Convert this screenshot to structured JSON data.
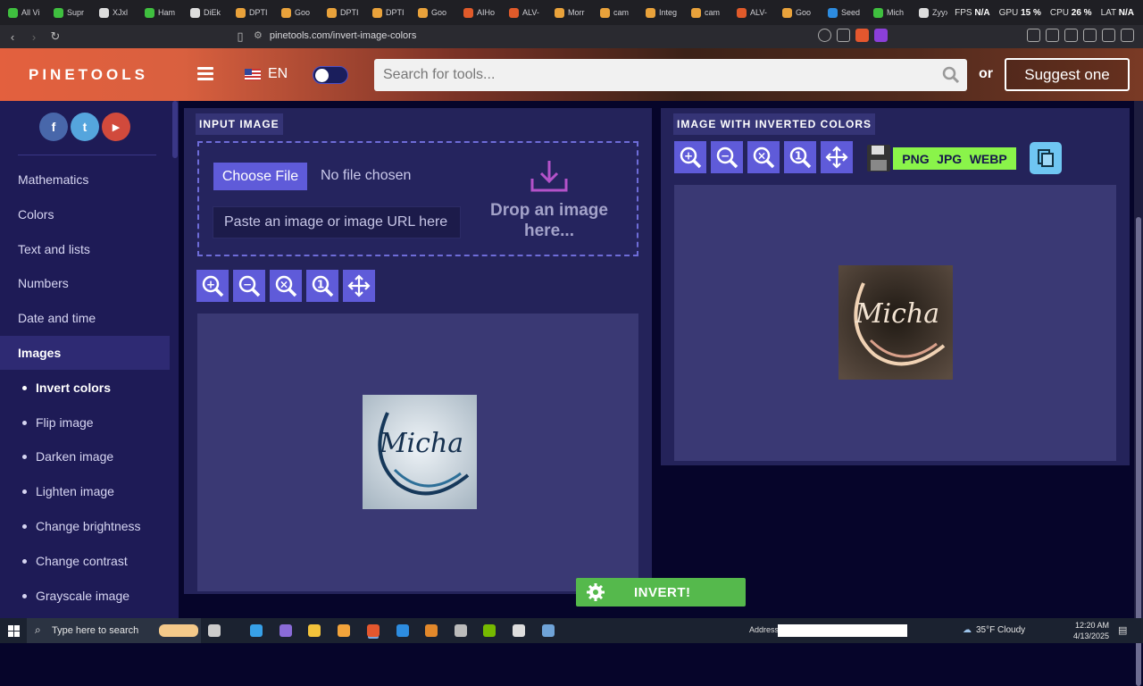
{
  "browser": {
    "tabs": [
      "All Vi",
      "Supr",
      "XJxl",
      "Ham",
      "DiEk",
      "DPTI",
      "Goo",
      "DPTI",
      "DPTI",
      "Goo",
      "AIHo",
      "ALV-",
      "Morr",
      "cam",
      "Integ",
      "cam",
      "ALV-",
      "Goo",
      "Seed",
      "Mich",
      "Zyyx"
    ],
    "perf": {
      "fps_label": "FPS",
      "fps_value": "N/A",
      "gpu_label": "GPU",
      "gpu_value": "15 %",
      "cpu_label": "CPU",
      "cpu_value": "26 %",
      "lat_label": "LAT",
      "lat_value": "N/A"
    },
    "url": "pinetools.com/invert-image-colors"
  },
  "header": {
    "logo": "PINETOOLS",
    "lang": "EN",
    "search_placeholder": "Search for tools...",
    "or": "or",
    "suggest": "Suggest one"
  },
  "sidebar": {
    "social": [
      "f",
      "t",
      "▶"
    ],
    "categories": [
      "Mathematics",
      "Colors",
      "Text and lists",
      "Numbers",
      "Date and time",
      "Images"
    ],
    "image_tools": [
      "Invert colors",
      "Flip image",
      "Darken image",
      "Lighten image",
      "Change brightness",
      "Change contrast",
      "Grayscale image"
    ]
  },
  "input_panel": {
    "title": "INPUT IMAGE",
    "choose_file": "Choose File",
    "no_file": "No file chosen",
    "paste_placeholder": "Paste an image or image URL here",
    "drop_text": "Drop an image here..."
  },
  "output_panel": {
    "title": "IMAGE WITH INVERTED COLORS",
    "formats": [
      "PNG",
      "JPG",
      "WEBP"
    ]
  },
  "image_text": "Micha",
  "invert_button": "INVERT!",
  "taskbar": {
    "search": "Type here to search",
    "address_label": "Address",
    "weather": "35°F  Cloudy",
    "time": "12:20 AM",
    "date": "4/13/2025"
  }
}
